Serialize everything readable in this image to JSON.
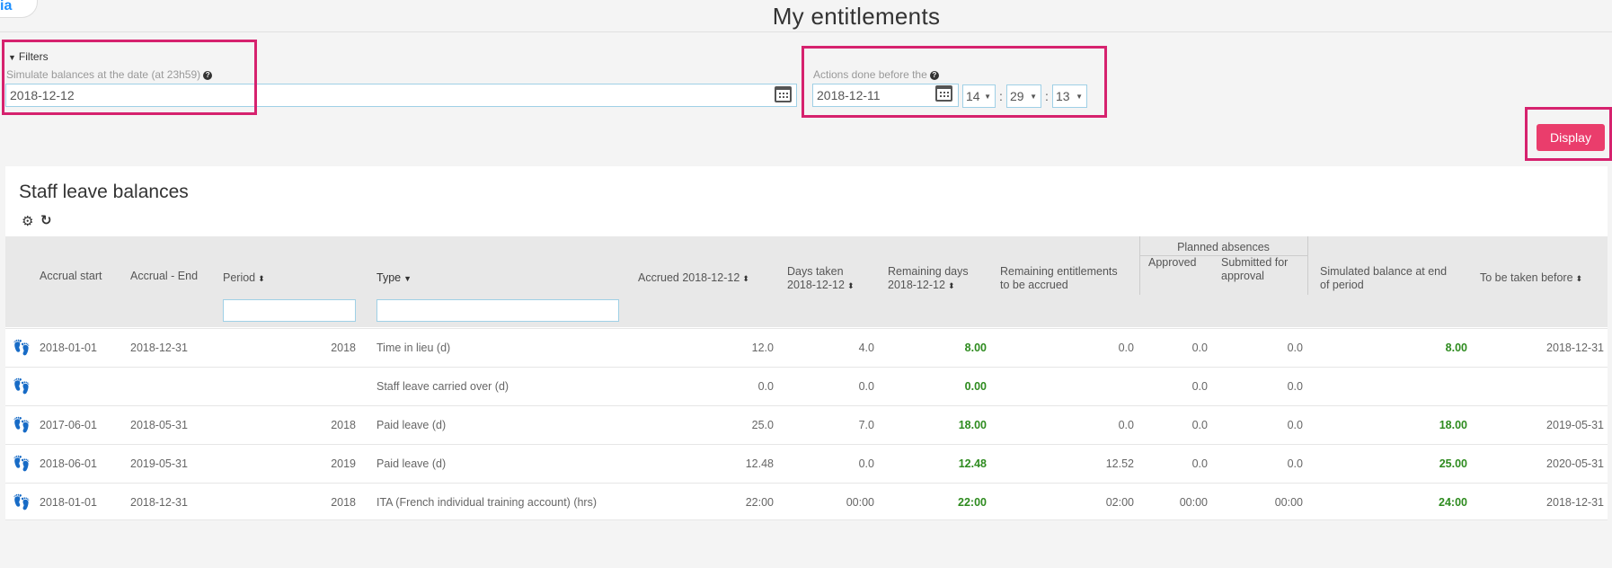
{
  "app": {
    "logo_text": "ia"
  },
  "page": {
    "title": "My entitlements"
  },
  "filters": {
    "toggle_label": "Filters",
    "simulate_label": "Simulate balances at the date (at 23h59)",
    "simulate_value": "2018-12-12",
    "actions_label": "Actions done before the",
    "actions_date": "2018-12-11",
    "hour": "14",
    "minute": "29",
    "second": "13",
    "separator": ":",
    "display_button": "Display"
  },
  "panel": {
    "title": "Staff leave balances",
    "columns": {
      "accrual_start": "Accrual start",
      "accrual_end": "Accrual - End",
      "period": "Period",
      "type": "Type",
      "accrued": "Accrued 2018-12-12",
      "days_taken_1": "Days taken",
      "days_taken_2": "2018-12-12",
      "remaining_1": "Remaining days",
      "remaining_2": "2018-12-12",
      "remaining_ent_1": "Remaining entitlements",
      "remaining_ent_2": "to be accrued",
      "planned_group": "Planned absences",
      "approved": "Approved",
      "submitted_1": "Submitted for",
      "submitted_2": "approval",
      "simulated_1": "Simulated balance at end",
      "simulated_2": "of period",
      "to_be_taken": "To be taken before"
    },
    "rows": [
      {
        "start": "2018-01-01",
        "end": "2018-12-31",
        "period": "2018",
        "type": "Time in lieu (d)",
        "accrued": "12.0",
        "taken": "4.0",
        "remaining": "8.00",
        "rem_ent": "0.0",
        "approved": "0.0",
        "submitted": "0.0",
        "simulated": "8.00",
        "before": "2018-12-31"
      },
      {
        "start": "",
        "end": "",
        "period": "",
        "type": "Staff leave carried over (d)",
        "accrued": "0.0",
        "taken": "0.0",
        "remaining": "0.00",
        "rem_ent": "",
        "approved": "0.0",
        "submitted": "0.0",
        "simulated": "",
        "before": ""
      },
      {
        "start": "2017-06-01",
        "end": "2018-05-31",
        "period": "2018",
        "type": "Paid leave (d)",
        "accrued": "25.0",
        "taken": "7.0",
        "remaining": "18.00",
        "rem_ent": "0.0",
        "approved": "0.0",
        "submitted": "0.0",
        "simulated": "18.00",
        "before": "2019-05-31"
      },
      {
        "start": "2018-06-01",
        "end": "2019-05-31",
        "period": "2019",
        "type": "Paid leave (d)",
        "accrued": "12.48",
        "taken": "0.0",
        "remaining": "12.48",
        "rem_ent": "12.52",
        "approved": "0.0",
        "submitted": "0.0",
        "simulated": "25.00",
        "before": "2020-05-31"
      },
      {
        "start": "2018-01-01",
        "end": "2018-12-31",
        "period": "2018",
        "type": "ITA (French individual training account) (hrs)",
        "accrued": "22:00",
        "taken": "00:00",
        "remaining": "22:00",
        "rem_ent": "02:00",
        "approved": "00:00",
        "submitted": "00:00",
        "simulated": "24:00",
        "before": "2018-12-31"
      }
    ]
  },
  "colors": {
    "accent": "#ea3d6c",
    "highlight": "#d6226e",
    "positive": "#2e8b1f",
    "input_border": "#9fd0e6"
  },
  "icons": [
    "help-icon",
    "calendar-icon",
    "gear-icon",
    "refresh-icon",
    "flip-flops-icon",
    "sort-icon"
  ]
}
